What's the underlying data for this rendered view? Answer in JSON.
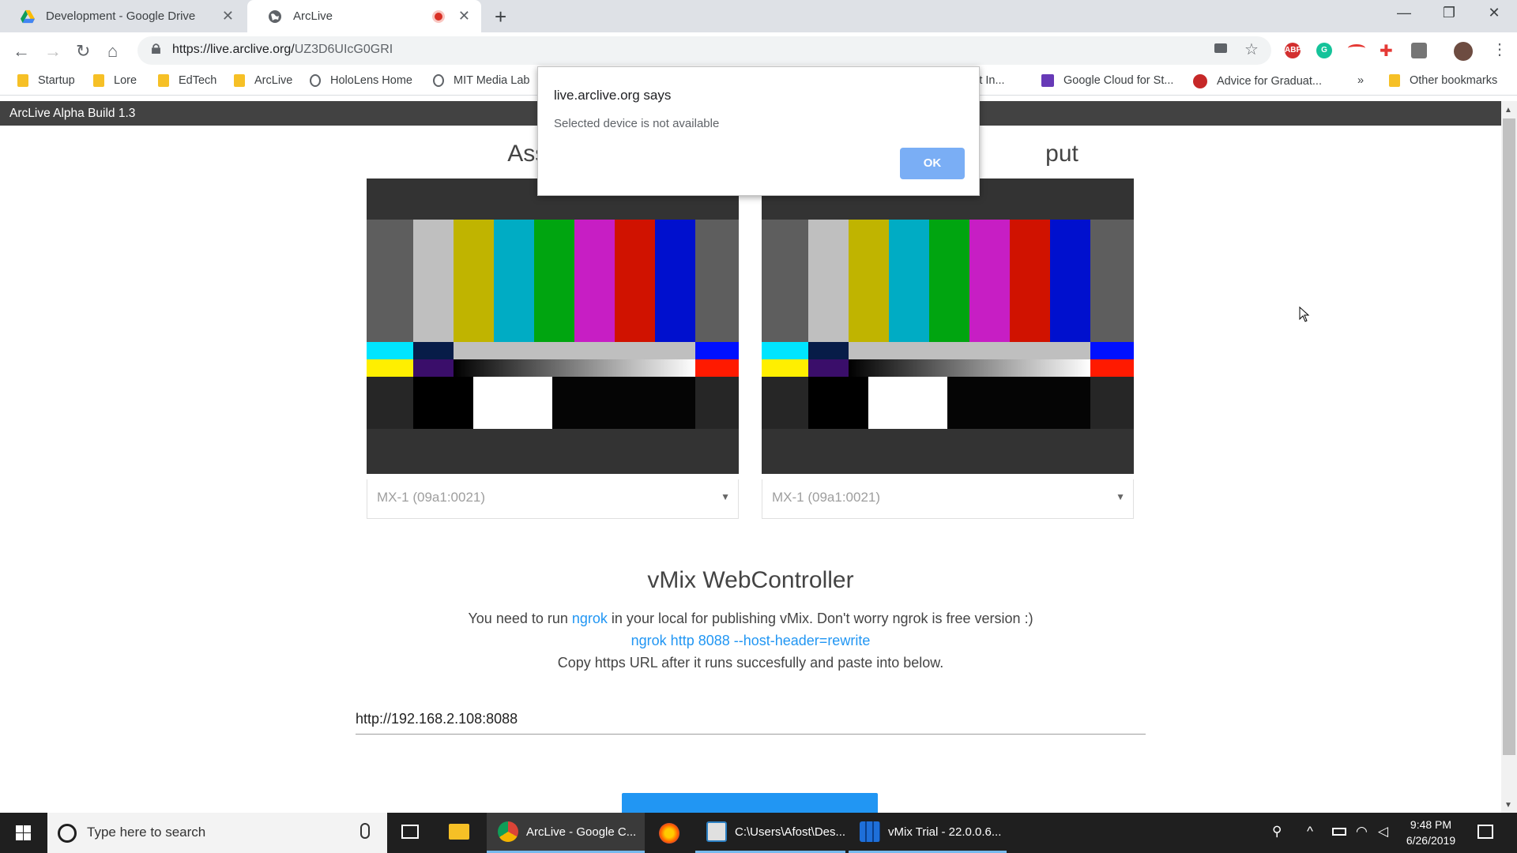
{
  "browser": {
    "tabs": [
      {
        "title": "Development - Google Drive",
        "active": false
      },
      {
        "title": "ArcLive",
        "active": true,
        "recording": true
      }
    ],
    "address": {
      "host": "https://live.arclive.org/",
      "path": "UZ3D6UIcG0GRI"
    },
    "bookmarks": [
      {
        "label": "Startup",
        "icon": "folder-icon"
      },
      {
        "label": "Lore",
        "icon": "folder-icon"
      },
      {
        "label": "EdTech",
        "icon": "folder-icon"
      },
      {
        "label": "ArcLive",
        "icon": "folder-icon"
      },
      {
        "label": "HoloLens Home",
        "icon": "globe-icon"
      },
      {
        "label": "MIT Media Lab",
        "icon": "globe-icon"
      },
      {
        "label": "act In...",
        "icon": "none"
      },
      {
        "label": "Google Cloud for St...",
        "icon": "form-icon"
      },
      {
        "label": "Advice for Graduat...",
        "icon": "red-circle-icon"
      },
      {
        "label": "»",
        "icon": "none"
      },
      {
        "label": "Other bookmarks",
        "icon": "folder-icon"
      }
    ],
    "extensions": [
      "camera-icon",
      "star-icon",
      "adblock-icon",
      "grammarly-icon",
      "arc-icon",
      "medical-cross-icon",
      "code-icon",
      "profile-avatar-icon",
      "more-vert-icon"
    ]
  },
  "app": {
    "title": "ArcLive Alpha Build 1.3",
    "panels": [
      {
        "title": "Assistan",
        "device": "MX-1 (09a1:0021)"
      },
      {
        "title": "put",
        "device": "MX-1 (09a1:0021)"
      }
    ],
    "vmix": {
      "title": "vMix WebController",
      "line1_prefix": "You need to run ",
      "line1_link": "ngrok",
      "line1_suffix": " in your local for publishing vMix. Don't worry ngrok is free version :)",
      "line2_link": "ngrok http 8088 --host-header=rewrite",
      "line3": "Copy https URL after it runs succesfully and paste into below.",
      "url_value": "http://192.168.2.108:8088"
    }
  },
  "dialog": {
    "title": "live.arclive.org says",
    "message": "Selected device is not available",
    "ok_label": "OK"
  },
  "taskbar": {
    "search_placeholder": "Type here to search",
    "items": [
      {
        "label": "ArcLive - Google C...",
        "icon": "chrome-icon",
        "state": "active"
      },
      {
        "label": "",
        "icon": "firefox-icon",
        "state": "closed"
      },
      {
        "label": "C:\\Users\\Afost\\Des...",
        "icon": "explorer-window-icon",
        "state": "open"
      },
      {
        "label": "vMix Trial - 22.0.0.6...",
        "icon": "vmix-icon",
        "state": "open"
      }
    ],
    "time": "9:48 PM",
    "date": "6/26/2019"
  },
  "colors": {
    "test_bars": [
      "#5e5e5e",
      "#bfbfbf",
      "#c0b400",
      "#00acc4",
      "#00a510",
      "#c71ec4",
      "#d01200",
      "#0010ce",
      "#5e5e5e"
    ],
    "link": "#2196f3",
    "appbar": "#424242"
  }
}
